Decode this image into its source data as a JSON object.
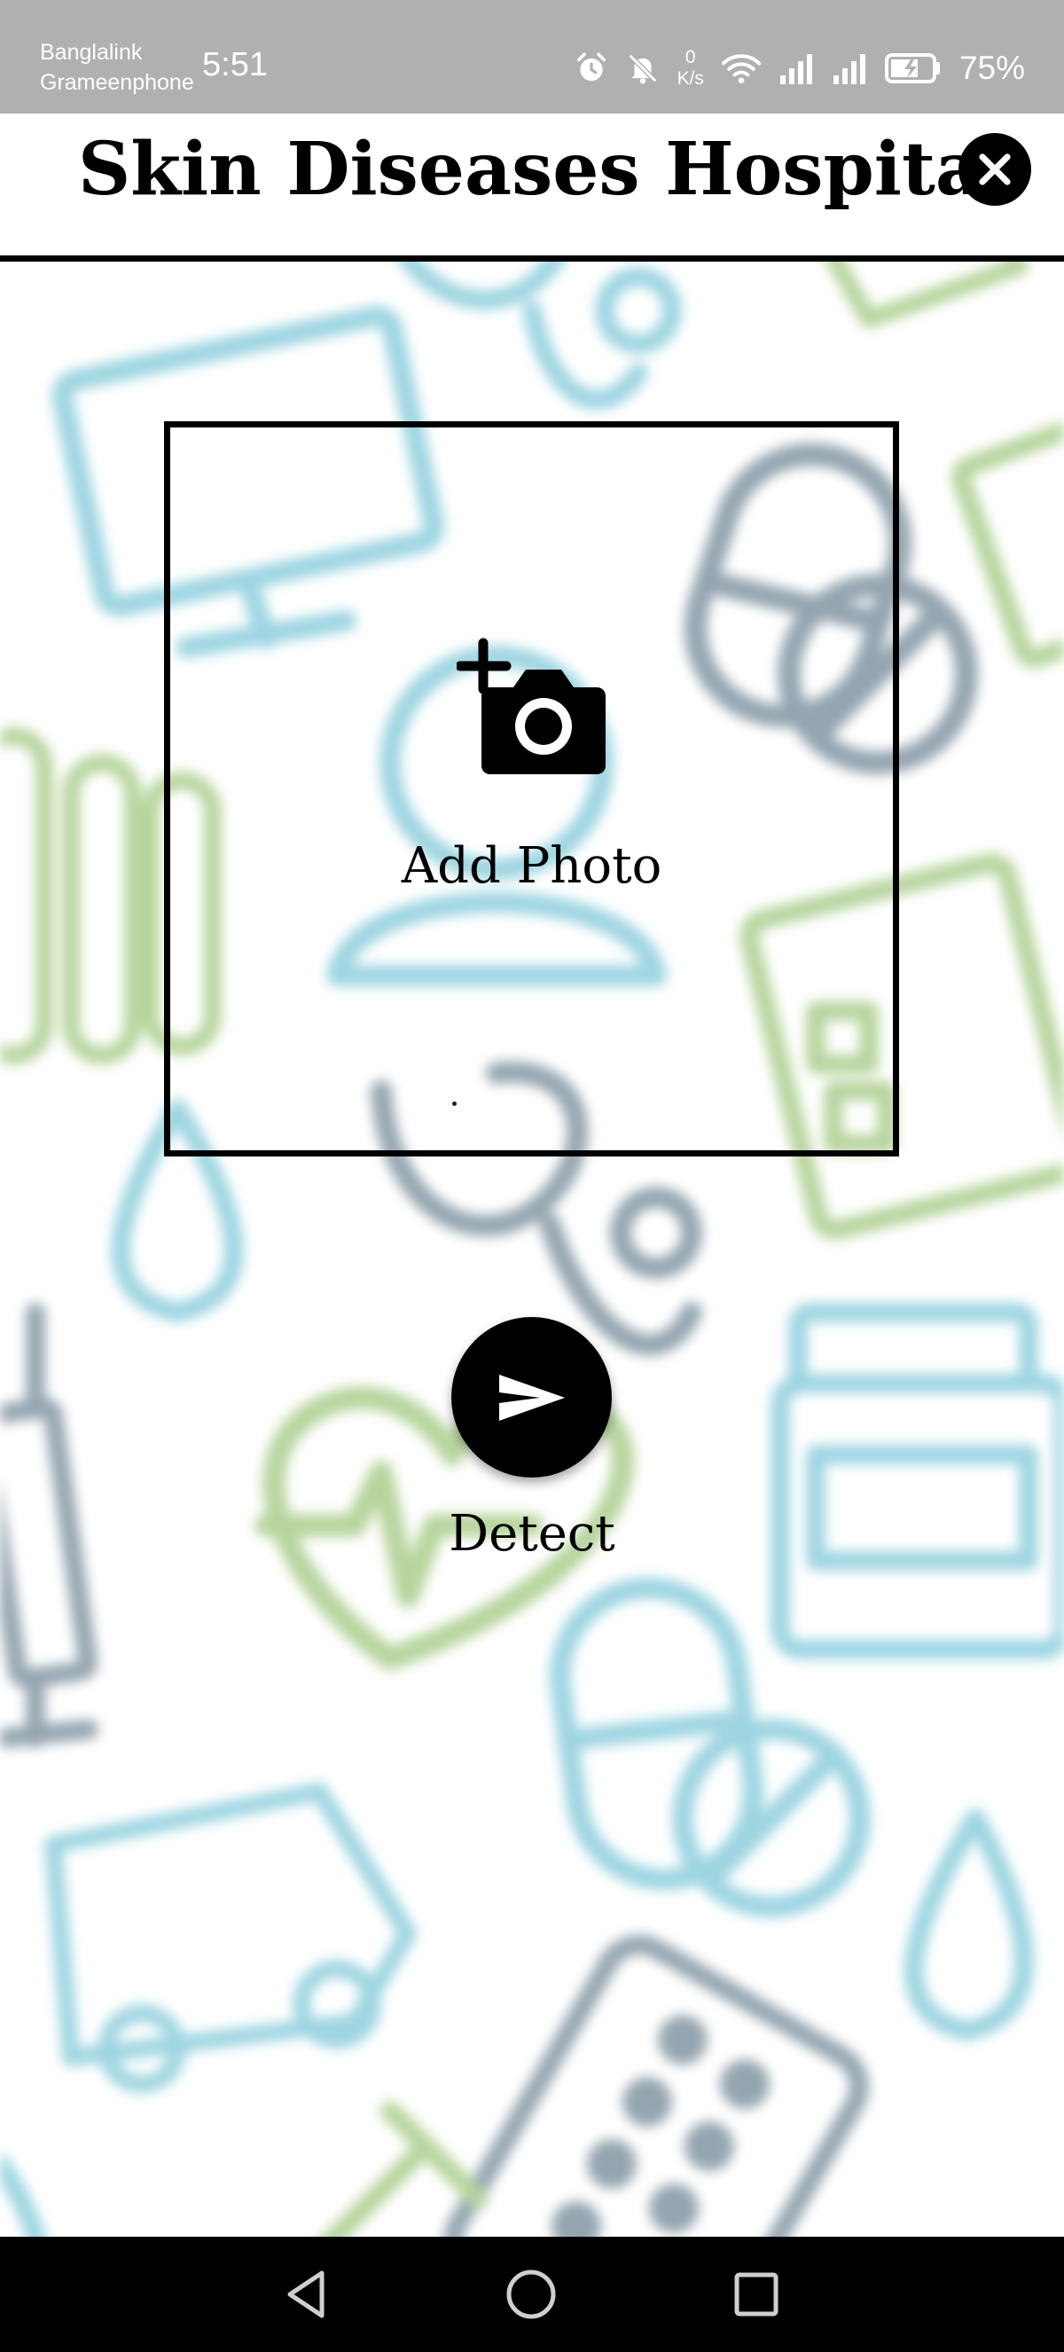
{
  "status_bar": {
    "carrier_1": "Banglalink",
    "carrier_2": "Grameenphone",
    "time": "5:51",
    "net_speed_value": "0",
    "net_speed_unit": "K/s",
    "battery_percent": "75%",
    "icons": [
      "alarm-icon",
      "mute-icon",
      "wifi-icon",
      "signal-icon",
      "signal-icon",
      "battery-charging-icon"
    ]
  },
  "header": {
    "title": "Skin Diseases Hospital",
    "close_icon": "close-icon"
  },
  "photo_box": {
    "label": "Add Photo",
    "icon": "add-photo-camera-icon"
  },
  "detect": {
    "label": "Detect",
    "icon": "send-icon"
  },
  "nav_bar": {
    "icons": [
      "back-triangle-icon",
      "home-circle-icon",
      "recents-square-icon"
    ]
  },
  "colors": {
    "status_bar": "#b0b0b0",
    "primary": "#000000",
    "background": "#ffffff",
    "bg_blue": "#4fb3c9",
    "bg_green": "#7db24e",
    "bg_slate": "#3e5c70"
  }
}
